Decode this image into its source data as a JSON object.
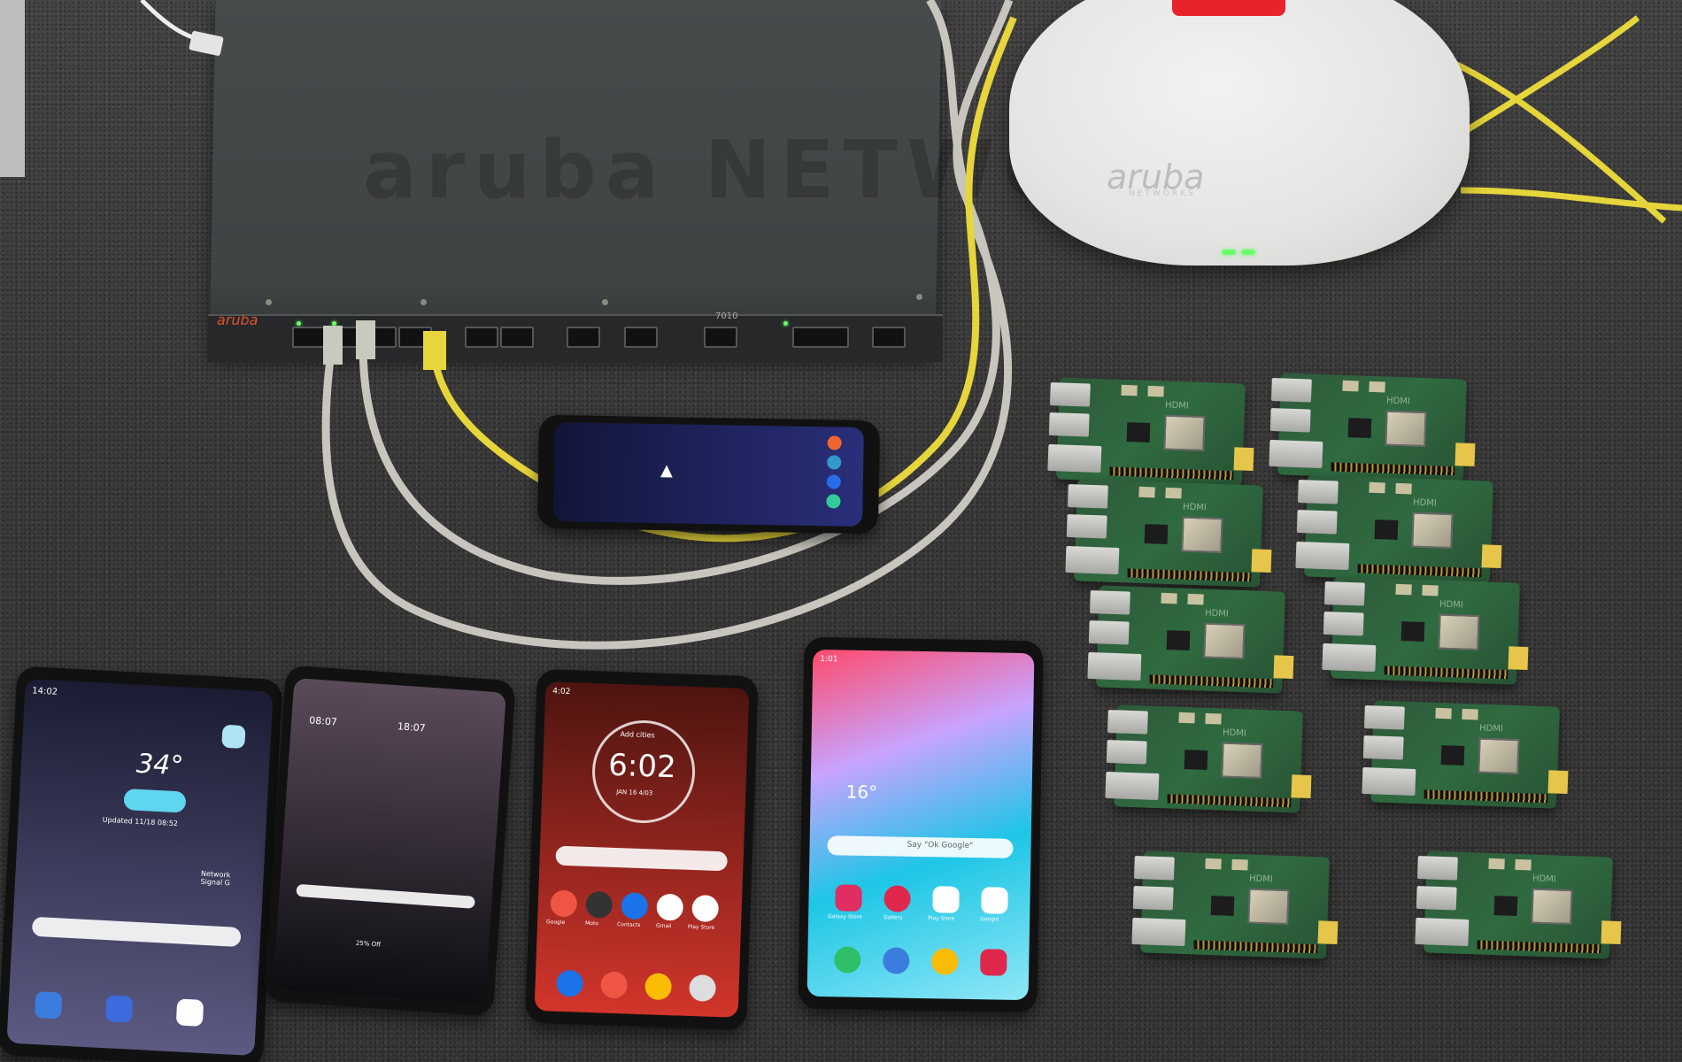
{
  "controller": {
    "brand": "aruba",
    "model": "7010",
    "watermark": "aruba NETWORKS"
  },
  "access_point": {
    "brand": "aruba",
    "subtext": "NETWORKS",
    "label_color": "#e8232b"
  },
  "phones": [
    {
      "name": "phone-1",
      "status_time": "14:02",
      "weather_temp": "34°",
      "weather_sub": "Updated 11/18 08:52",
      "side_label": "Network Signal G",
      "screen_top": "#1b1c33",
      "screen_bottom": "#5c5a82"
    },
    {
      "name": "phone-2",
      "clock_left": "08:07",
      "clock_right": "18:07",
      "footer": "25% Off",
      "screen_top": "#5b4a5a",
      "screen_bottom": "#0d0d12"
    },
    {
      "name": "phone-3",
      "status_time": "4:02",
      "clock": "6:02",
      "clock_sub": "Add cities",
      "date": "JAN 16  4/03",
      "apps": [
        "Google",
        "Moto",
        "Contacts",
        "Gmail",
        "Play Store"
      ],
      "screen_top": "#4d1410",
      "screen_bottom": "#d2352b"
    },
    {
      "name": "phone-4",
      "status_time": "1:01",
      "temp": "16°",
      "search": "Say \"Ok Google\"",
      "apps": [
        "Galaxy Store",
        "Gallery",
        "Play Store",
        "Google"
      ],
      "screen_top": "#ff4a6b",
      "screen_bottom": "#1ec6e6"
    },
    {
      "name": "phone-5",
      "screen_top": "#12153a",
      "screen_bottom": "#2a2f7a"
    }
  ],
  "raspberry_pi": {
    "hdmi_label": "HDMI",
    "count": 10
  },
  "colors": {
    "cable_gray": "#c7c5bd",
    "cable_yellow": "#e6d53b",
    "carpet": "#3b3b3b"
  }
}
